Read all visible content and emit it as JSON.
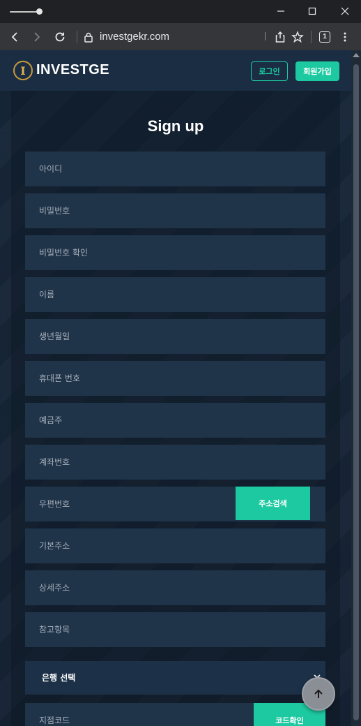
{
  "browser": {
    "url": "investgekr.com",
    "tab_count": "1"
  },
  "header": {
    "logo_letter": "I",
    "logo_text": "INVESTGE",
    "login_label": "로그인",
    "join_label": "회원가입"
  },
  "form": {
    "title": "Sign up",
    "fields": [
      {
        "placeholder": "아이디"
      },
      {
        "placeholder": "비밀번호"
      },
      {
        "placeholder": "비밀번호 확인"
      },
      {
        "placeholder": "이름"
      },
      {
        "placeholder": "생년월일"
      },
      {
        "placeholder": "휴대폰 번호"
      },
      {
        "placeholder": "예금주"
      },
      {
        "placeholder": "계좌번호"
      },
      {
        "placeholder": "우편번호"
      },
      {
        "placeholder": "기본주소"
      },
      {
        "placeholder": "상세주소"
      },
      {
        "placeholder": "참고항목"
      }
    ],
    "address_search_label": "주소검색",
    "bank_select_label": "은행 선택",
    "branch_code_placeholder": "지점코드",
    "code_check_label": "코드확인"
  },
  "colors": {
    "accent": "#1dc9a0",
    "background": "#152232",
    "field": "#1f3349"
  }
}
